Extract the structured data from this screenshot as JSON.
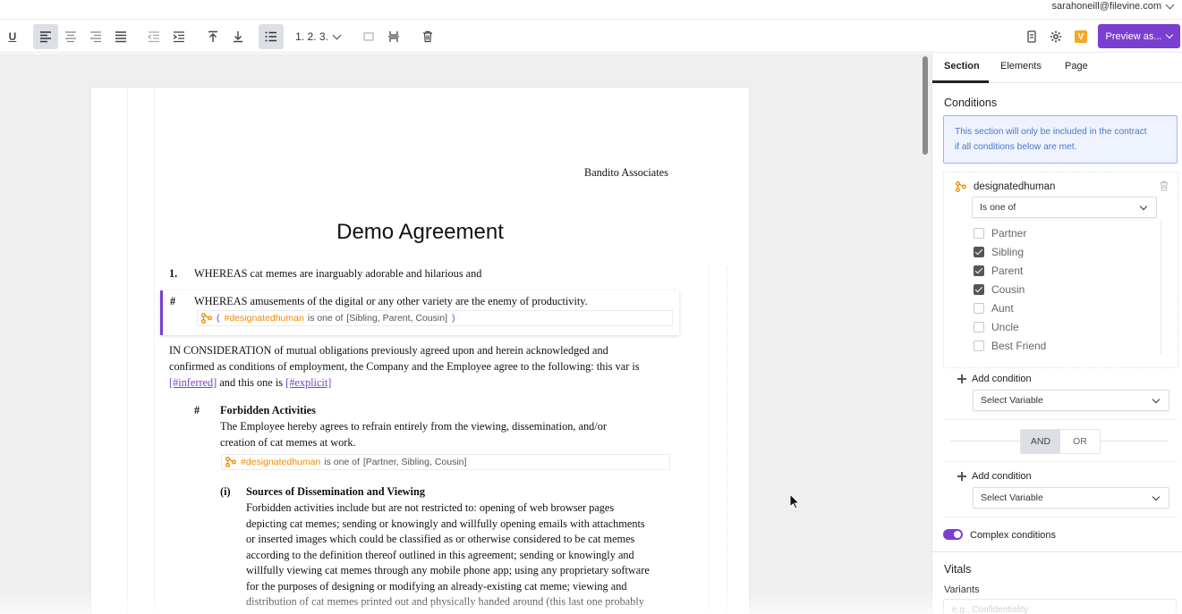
{
  "user": {
    "email": "sarahoneill@filevine.com"
  },
  "toolbar": {
    "underline_label": "U",
    "numbered_list_label": "1. 2. 3.",
    "preview_label": "Preview as...",
    "badge_letter": "V",
    "accent": "#7a3fd1"
  },
  "document": {
    "company": "Bandito Associates",
    "title": "Demo Agreement",
    "item1": {
      "number": "1.",
      "text": "WHEREAS cat memes are inarguably adorable and hilarious and"
    },
    "item2": {
      "number": "#",
      "text": "WHEREAS amusements of the digital or any other variety are the enemy of productivity.",
      "condition": {
        "open": "(",
        "variable": "#designatedhuman",
        "op": " is one of ",
        "values": "[Sibling, Parent, Cousin]",
        "close": ")"
      }
    },
    "consideration": {
      "line1": "IN CONSIDERATION of mutual obligations previously agreed upon and herein acknowledged and",
      "line2": "confirmed as conditions of employment, the Company and the Employee agree to the following: this var is",
      "var1": "[#inferred]",
      "mid": " and this one is ",
      "var2": "[#explicit]"
    },
    "forbidden": {
      "number": "#",
      "heading": "Forbidden Activities",
      "line1": "The Employee hereby agrees to refrain entirely from the viewing, dissemination, and/or",
      "line2": "creation of cat memes at work.",
      "condition": {
        "variable": "#designatedhuman",
        "op": " is one of ",
        "values": "[Partner, Sibling, Cousin]"
      }
    },
    "sources": {
      "number": "(i)",
      "heading": "Sources of Dissemination and Viewing",
      "lines": [
        "Forbidden activities include but are not restricted to: opening of web browser pages",
        "depicting cat memes; sending or knowingly and willfully opening emails with attachments",
        "or inserted images which could be classified as or otherwise considered to be cat memes",
        "according to the definition thereof outlined in this agreement; sending or knowingly and",
        "willfully viewing cat memes through any mobile phone app; using any proprietary software",
        "for the purposes of designing or modifying an already-existing cat meme; viewing and",
        "distribution of cat memes printed out and physically handed around (this last one probably"
      ]
    }
  },
  "panel": {
    "tabs": [
      "Section",
      "Elements",
      "Page"
    ],
    "active_tab": "Section",
    "conditions_heading": "Conditions",
    "info_line1": "This section will only be included in the contract",
    "info_line2": "if all conditions below are met.",
    "condition": {
      "variable": "designatedhuman",
      "operator": "Is one of",
      "options": [
        {
          "label": "Partner",
          "checked": false
        },
        {
          "label": "Sibling",
          "checked": true
        },
        {
          "label": "Parent",
          "checked": true
        },
        {
          "label": "Cousin",
          "checked": true
        },
        {
          "label": "Aunt",
          "checked": false
        },
        {
          "label": "Uncle",
          "checked": false
        },
        {
          "label": "Best Friend",
          "checked": false
        }
      ]
    },
    "add_condition": "Add condition",
    "select_variable": "Select Variable",
    "and_label": "AND",
    "or_label": "OR",
    "logic_selected": "AND",
    "complex_conditions": "Complex conditions",
    "complex_enabled": true,
    "vitals_heading": "Vitals",
    "variants_label": "Variants",
    "variants_placeholder": "e.g., Confidentiality"
  }
}
